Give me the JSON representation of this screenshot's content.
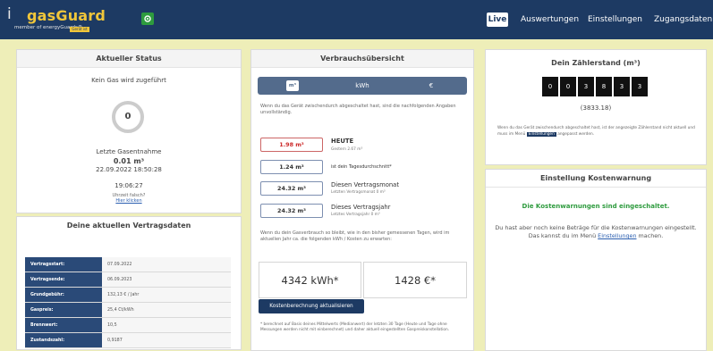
{
  "header": {
    "logo_i": "i",
    "logo_title": "gasGuard",
    "logo_subtitle": "member of energyGuards®",
    "logo_badge": "Gerät ist aktiv",
    "nav": [
      "Live",
      "Auswertungen",
      "Einstellungen",
      "Zugangsdaten"
    ]
  },
  "status_card": {
    "title": "Aktueller Status",
    "status_text": "Kein Gas wird zugeführt",
    "ring_value": "0",
    "last_label": "Letzte Gasentnahme",
    "last_value": "0.01 m³",
    "last_time": "22.09.2022 18:50:28",
    "clock": "19:06:27",
    "note": "Uhrzeit falsch?",
    "note_link": "Hier klicken"
  },
  "contract_card": {
    "title": "Deine aktuellen Vertragsdaten",
    "rows": [
      {
        "key": "Vertragsstart:",
        "value": "07.09.2022"
      },
      {
        "key": "Vertragsende:",
        "value": "06.09.2023"
      },
      {
        "key": "Grundgebühr:",
        "value": "132,13 € / Jahr"
      },
      {
        "key": "Gaspreis:",
        "value": "25,4 Ct/kWh"
      },
      {
        "key": "Brennwert:",
        "value": "10,5"
      },
      {
        "key": "Zustandszahl:",
        "value": "0,9187"
      }
    ]
  },
  "usage_card": {
    "title": "Verbrauchsübersicht",
    "tabs": [
      "m³",
      "kWh",
      "€"
    ],
    "intro": "Wenn du das Gerät zwischendurch abgeschaltet hast, sind die nachfolgenden Angaben unvollständig.",
    "tiles": [
      {
        "value": "1.98 m³",
        "title": "HEUTE",
        "sub": "Gestern 2.67 m³"
      },
      {
        "value": "1.24 m³",
        "title": "ist dein Tagesdurchschnitt*",
        "sub": ""
      },
      {
        "value": "24.32 m³",
        "title": "Diesen Vertragsmonat",
        "sub": "Letzten Vertragsmonat 0 m³"
      },
      {
        "value": "24.32 m³",
        "title": "Dieses Vertragsjahr",
        "sub": "Letztes Vertragsjahr 0 m³"
      }
    ],
    "info": "Wenn du dein Gasverbrauch so bleibt, wie in den bisher gemessenen Tagen, wird im aktuellen Jahr ca. die folgenden kWh / Kosten zu erwarten:",
    "forecast_kwh": "4342 kWh*",
    "forecast_eur": "1428 €*",
    "button": "Kostenberechnung aktualisieren",
    "footnote": "* berechnet auf Basis deines Mittelwerts (Medianwert) der letzten 30 Tage (Heute und Tage ohne Messungen werden nicht mit einberechnet) und daher aktuell eingestellten Gaspreiskonstellation."
  },
  "meter_card": {
    "title": "Dein Zählerstand (m³)",
    "digits": [
      "0",
      "0",
      "3",
      "8",
      "3",
      "3"
    ],
    "reading": "(3833.18)",
    "note_pre": "Wenn du das Gerät zwischendurch abgeschaltet hast, ist der angezeigte Zählerstand nicht aktuell und muss im Menü",
    "note_hl": "Einstellungen",
    "note_post": "angepasst werden."
  },
  "cost_card": {
    "title": "Einstellung Kostenwarnung",
    "status": "Die Kostenwarnungen sind eingeschaltet.",
    "text_pre": "Du hast aber noch keine Beträge für die Kostenwarnungen eingestellt. Das kannst du im Menü",
    "text_link": "Einstellungen",
    "text_post": "machen.",
    "colors": {
      "green": "#2e9b3e",
      "navy": "#1d3a63",
      "red": "#cc2a2a"
    }
  }
}
